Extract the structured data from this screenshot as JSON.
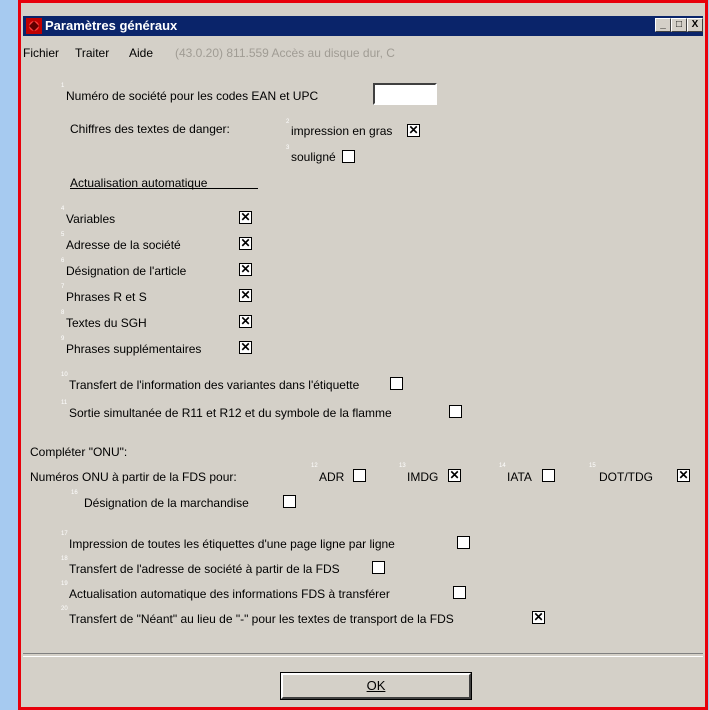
{
  "window": {
    "title": "Paramètres généraux",
    "controls": [
      "_",
      "□",
      "X"
    ]
  },
  "menu": {
    "file": "Fichier",
    "process": "Traiter",
    "help": "Aide",
    "info": "(43.0.20) 811.559 Accès au disque dur, C"
  },
  "form": {
    "company_number": {
      "num": "1",
      "label": "Numéro de société pour les codes EAN et UPC",
      "value": ""
    },
    "danger_digits_label": "Chiffres des textes de danger:",
    "bold_print": {
      "num": "2",
      "label": "impression en gras",
      "checked": true
    },
    "underlined": {
      "num": "3",
      "label": "souligné",
      "checked": false
    },
    "auto_update_heading": "Actualisation automatique",
    "auto_items": [
      {
        "num": "4",
        "label": "Variables",
        "checked": true
      },
      {
        "num": "5",
        "label": "Adresse de la société",
        "checked": true
      },
      {
        "num": "6",
        "label": "Désignation de l'article",
        "checked": true
      },
      {
        "num": "7",
        "label": "Phrases R et S",
        "checked": true
      },
      {
        "num": "8",
        "label": "Textes du SGH",
        "checked": true
      },
      {
        "num": "9",
        "label": "Phrases supplémentaires",
        "checked": true
      }
    ],
    "variant_transfer": {
      "num": "10",
      "label": "Transfert de l'information des variantes dans l'étiquette",
      "checked": false
    },
    "simultaneous_output": {
      "num": "11",
      "label": "Sortie simultanée de R11 et R12 et du symbole de la flamme",
      "checked": false
    },
    "onu_heading": "Compléter \"ONU\":",
    "onu_numbers_label": "Numéros ONU à partir de la FDS pour:",
    "onu_options": [
      {
        "num": "12",
        "label": "ADR",
        "checked": false
      },
      {
        "num": "13",
        "label": "IMDG",
        "checked": true
      },
      {
        "num": "14",
        "label": "IATA",
        "checked": false
      },
      {
        "num": "15",
        "label": "DOT/TDG",
        "checked": true
      }
    ],
    "goods_designation": {
      "num": "16",
      "label": "Désignation de la marchandise",
      "checked": false
    },
    "bottom_items": [
      {
        "num": "17",
        "label": "Impression de toutes les étiquettes d'une page ligne par ligne",
        "checked": false
      },
      {
        "num": "18",
        "label": "Transfert de l'adresse de société à partir de la FDS",
        "checked": false
      },
      {
        "num": "19",
        "label": "Actualisation automatique des informations FDS à transférer",
        "checked": false
      },
      {
        "num": "20",
        "label": "Transfert de \"Néant\" au lieu de \"-\" pour les textes de transport de la FDS",
        "checked": true
      }
    ]
  },
  "ok_button": {
    "label": "OK"
  },
  "colors": {
    "title_bar": "#0a246a",
    "window_border": "#e8000b",
    "desktop": "#a6caf0",
    "dialog_bg": "#d4d0c8"
  }
}
